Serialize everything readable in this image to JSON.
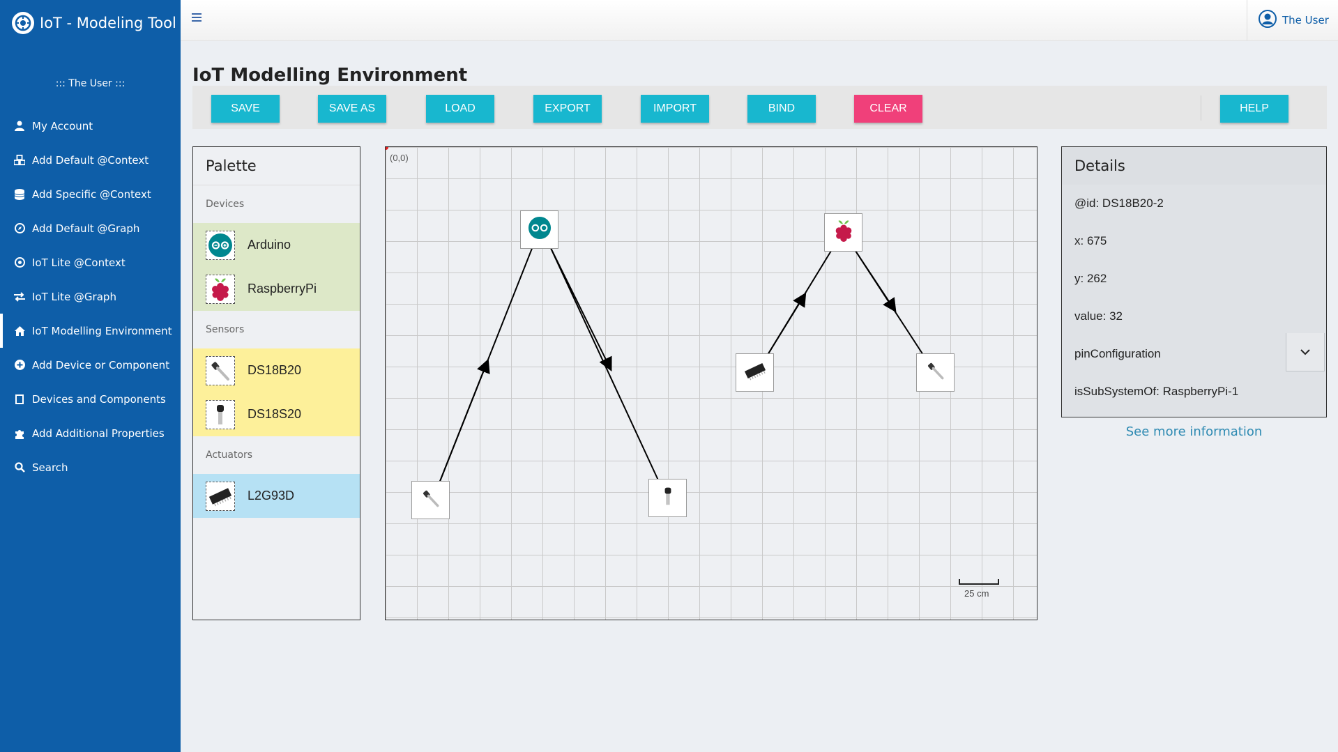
{
  "app": {
    "title": "IoT - Modeling Tool"
  },
  "sidebar": {
    "user_banner": "::: The User :::",
    "items": [
      {
        "label": "My Account",
        "icon": "user-icon"
      },
      {
        "label": "Add Default @Context",
        "icon": "cubes-icon"
      },
      {
        "label": "Add Specific @Context",
        "icon": "database-icon"
      },
      {
        "label": "Add Default @Graph",
        "icon": "compass-icon"
      },
      {
        "label": "IoT Lite @Context",
        "icon": "target-icon"
      },
      {
        "label": "IoT Lite @Graph",
        "icon": "exchange-icon"
      },
      {
        "label": "IoT Modelling Environment",
        "icon": "home-icon",
        "active": true
      },
      {
        "label": "Add Device or Component",
        "icon": "plus-circle-icon"
      },
      {
        "label": "Devices and Components",
        "icon": "square-icon"
      },
      {
        "label": "Add Additional Properties",
        "icon": "puzzle-icon"
      },
      {
        "label": "Search",
        "icon": "search-icon"
      }
    ]
  },
  "topbar": {
    "user_name": "The User"
  },
  "page": {
    "title": "IoT Modelling Environment"
  },
  "toolbar": {
    "save": "SAVE",
    "save_as": "SAVE AS",
    "load": "LOAD",
    "export": "EXPORT",
    "import": "IMPORT",
    "bind": "BIND",
    "clear": "CLEAR",
    "help": "HELP"
  },
  "palette": {
    "title": "Palette",
    "devices_label": "Devices",
    "sensors_label": "Sensors",
    "actuators_label": "Actuators",
    "devices": [
      "Arduino",
      "RaspberryPi"
    ],
    "sensors": [
      "DS18B20",
      "DS18S20"
    ],
    "actuators": [
      "L2G93D"
    ]
  },
  "canvas": {
    "origin_label": "(0,0)",
    "scale_label": "25 cm"
  },
  "details": {
    "title": "Details",
    "id": "@id: DS18B20-2",
    "x": "x: 675",
    "y": "y: 262",
    "value": "value: 32",
    "pin_configuration": "pinConfiguration",
    "sub_system": "isSubSystemOf: RaspberryPi-1",
    "more_info": "See more information"
  },
  "colors": {
    "sidebar": "#0e5ea8",
    "button": "#18b7cf",
    "clear_button": "#f0407a",
    "device_bg": "#dde8c8",
    "sensor_bg": "#fdf09a",
    "actuator_bg": "#b6e1f4"
  }
}
